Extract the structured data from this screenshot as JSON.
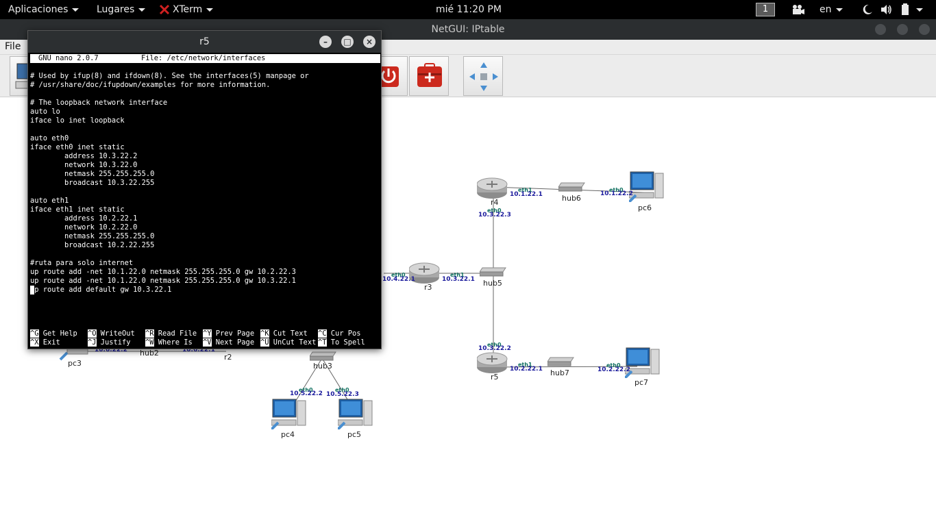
{
  "topbar": {
    "applications": "Aplicaciones",
    "places": "Lugares",
    "active_app": "XTerm",
    "clock": "mié 11:20 PM",
    "workspace": "1",
    "keyboard_layout": "en"
  },
  "netgui": {
    "window_title": "NetGUI: IPtable",
    "menu": [
      "File"
    ]
  },
  "xterm": {
    "window_title": "r5",
    "nano_header_version": "GNU nano 2.0.7",
    "nano_header_file": "File: /etc/network/interfaces",
    "lines": [
      "# Used by ifup(8) and ifdown(8). See the interfaces(5) manpage or",
      "# /usr/share/doc/ifupdown/examples for more information.",
      "",
      "# The loopback network interface",
      "auto lo",
      "iface lo inet loopback",
      "",
      "auto eth0",
      "iface eth0 inet static",
      "        address 10.3.22.2",
      "        network 10.3.22.0",
      "        netmask 255.255.255.0",
      "        broadcast 10.3.22.255",
      "",
      "auto eth1",
      "iface eth1 inet static",
      "        address 10.2.22.1",
      "        network 10.2.22.0",
      "        netmask 255.255.255.0",
      "        broadcast 10.2.22.255",
      "",
      "#ruta para solo internet",
      "up route add -net 10.1.22.0 netmask 255.255.255.0 gw 10.2.22.3",
      "up route add -net 10.1.22.0 netmask 255.255.255.0 gw 10.3.22.1",
      "up route add default gw 10.3.22.1"
    ],
    "shortcuts": [
      [
        {
          "key": "^G",
          "label": "Get Help"
        },
        {
          "key": "^X",
          "label": "Exit"
        }
      ],
      [
        {
          "key": "^O",
          "label": "WriteOut"
        },
        {
          "key": "^J",
          "label": "Justify"
        }
      ],
      [
        {
          "key": "^R",
          "label": "Read File"
        },
        {
          "key": "^W",
          "label": "Where Is"
        }
      ],
      [
        {
          "key": "^Y",
          "label": "Prev Page"
        },
        {
          "key": "^V",
          "label": "Next Page"
        }
      ],
      [
        {
          "key": "^K",
          "label": "Cut Text"
        },
        {
          "key": "^U",
          "label": "UnCut Text"
        }
      ],
      [
        {
          "key": "^C",
          "label": "Cur Pos"
        },
        {
          "key": "^T",
          "label": "To Spell"
        }
      ]
    ]
  },
  "diagram": {
    "nodes": {
      "r4": "r4",
      "hub6": "hub6",
      "pc6": "pc6",
      "r3": "r3",
      "hub5": "hub5",
      "r5": "r5",
      "hub7": "hub7",
      "pc7": "pc7",
      "pc3": "pc3",
      "hub2": "hub2",
      "r2": "r2",
      "hub3": "hub3",
      "pc4": "pc4",
      "pc5": "pc5"
    },
    "interfaces": {
      "r4_eth1": "eth1",
      "r4_eth1_ip": "10.1.22.1",
      "pc6_eth0": "eth0",
      "pc6_eth0_ip": "10.1.22.2",
      "r4_eth0": "eth0",
      "r4_eth0_ip": "10.3.22.3",
      "r3_eth0": "eth0",
      "r3_eth0_ip": "10.4.22.1",
      "r3_eth1": "eth1",
      "r3_eth1_ip": "10.3.22.1",
      "r5_eth0": "eth0",
      "r5_eth0_ip": "10.3.22.2",
      "r5_eth1": "eth1",
      "r5_eth1_ip": "10.2.22.1",
      "pc7_eth0": "eth0",
      "pc7_eth0_ip": "10.2.22.2",
      "pc3_ip": "10.6.22.2",
      "r2_ip": "10.6.22.1",
      "pc4_eth0": "eth0",
      "pc4_eth0_ip": "10.5.22.2",
      "pc5_eth0": "eth0",
      "pc5_eth0_ip": "10.5.22.3"
    }
  },
  "colors": {
    "topbar_bg": "#000000",
    "terminal_bg": "#000000",
    "terminal_fg": "#ffffff",
    "ip_label": "#1a1a9c",
    "eth_label": "#107060",
    "power_button": "#cc2a1e"
  },
  "icons": [
    "x-icon",
    "camera-icon",
    "night-mode-icon",
    "volume-icon",
    "battery-icon",
    "power-icon",
    "add-device-icon",
    "move-arrows-icon",
    "router-icon",
    "hub-icon",
    "pc-icon"
  ]
}
